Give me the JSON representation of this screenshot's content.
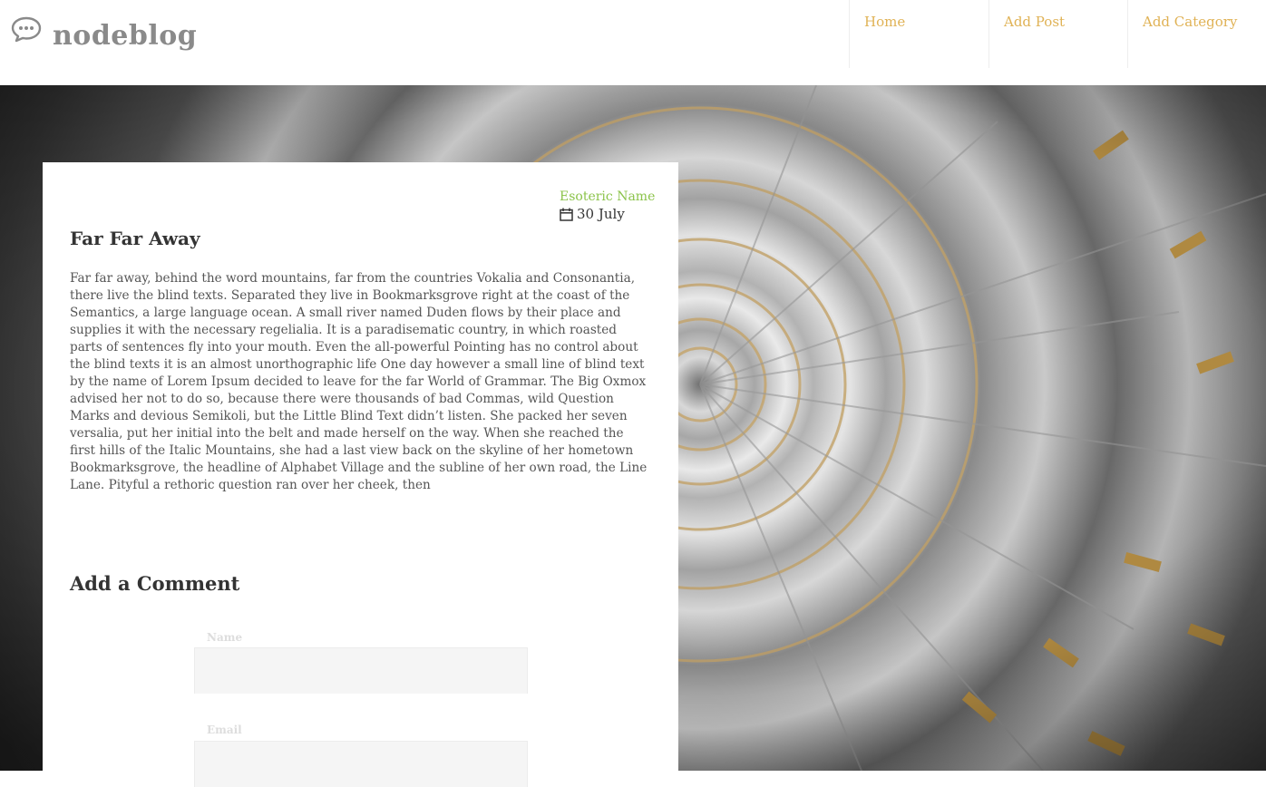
{
  "site": {
    "logo_icon": "speech-bubble-icon",
    "name": "nodeblog"
  },
  "nav": {
    "items": [
      {
        "label": "Home"
      },
      {
        "label": "Add Post"
      },
      {
        "label": "Add Category"
      }
    ]
  },
  "post": {
    "author": "Esoteric Name",
    "date_icon": "calendar-icon",
    "date": "30 July",
    "title": "Far Far Away",
    "body": "Far far away, behind the word mountains, far from the countries Vokalia and Consonantia, there live the blind texts. Separated they live in Bookmarksgrove right at the coast of the Semantics, a large language ocean. A small river named Duden flows by their place and supplies it with the necessary regelialia. It is a paradisematic country, in which roasted parts of sentences fly into your mouth. Even the all-powerful Pointing has no control about the blind texts it is an almost unorthographic life One day however a small line of blind text by the name of Lorem Ipsum decided to leave for the far World of Grammar. The Big Oxmox advised her not to do so, because there were thousands of bad Commas, wild Question Marks and devious Semikoli, but the Little Blind Text didn’t listen. She packed her seven versalia, put her initial into the belt and made herself on the way. When she reached the first hills of the Italic Mountains, she had a last view back on the skyline of her hometown Bookmarksgrove, the headline of Alphabet Village and the subline of her own road, the Line Lane. Pityful a rethoric question ran over her cheek, then"
  },
  "comment_form": {
    "heading": "Add a Comment",
    "name_label": "Name",
    "name_value": "",
    "email_label": "Email",
    "email_value": ""
  },
  "colors": {
    "accent_gold": "#e0b255",
    "author_green": "#8bc34a"
  }
}
